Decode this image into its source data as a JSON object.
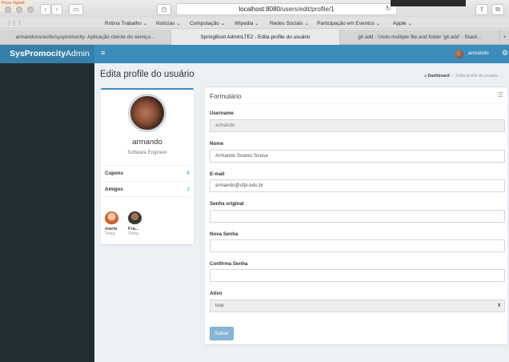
{
  "browser": {
    "url_host": "localhost:8080",
    "url_path": "/users/edit/profile/1",
    "maps_label": "Pizza Vignoli",
    "bookmarks": [
      "Rotina Trabalho ⌄",
      "Notícias ⌄",
      "Computação ⌄",
      "Wipedia ⌄",
      "Redes Sociais ⌄",
      "Participação em Eventos ⌄",
      "Apple ⌄"
    ],
    "tabs": [
      "armandossrecife/syspromocity: Aplicação cliente do serviço...",
      "SpringBoot AdminLTE2 - Edita profile do usuário",
      "git add - Undo multiple file and folder 'git add' - Stack..."
    ],
    "active_tab_index": 1
  },
  "header": {
    "logo_bold": "SysPromocity",
    "logo_light": "Admin",
    "user_name": "armando"
  },
  "page": {
    "title": "Edita profile do usuário",
    "breadcrumb_home": "Dashboard",
    "breadcrumb_current": "Edita profile do usuário"
  },
  "profile": {
    "name": "armando",
    "role": "Software Engineer",
    "rows": [
      {
        "label": "Cupons",
        "value": "6"
      },
      {
        "label": "Amigos",
        "value": "2"
      }
    ],
    "friends": [
      {
        "name": "maria",
        "date": "Today"
      },
      {
        "name": "Fra...",
        "date": "Today"
      }
    ]
  },
  "form": {
    "title": "Formulário",
    "username_label": "Username",
    "username_value": "armando",
    "nome_label": "Nome",
    "nome_value": "Armando Soares Sousa",
    "email_label": "E-mail",
    "email_value": "armando@ufpi.edu.br",
    "senha_original_label": "Senha original",
    "nova_senha_label": "Nova Senha",
    "confirma_senha_label": "Confirma Senha",
    "ativo_label": "Ativo",
    "ativo_value": "true",
    "submit_label": "Salvar"
  },
  "colors": {
    "header": "#3c8dbc",
    "sidebar": "#222d32",
    "accent": "#3c8dbc"
  }
}
